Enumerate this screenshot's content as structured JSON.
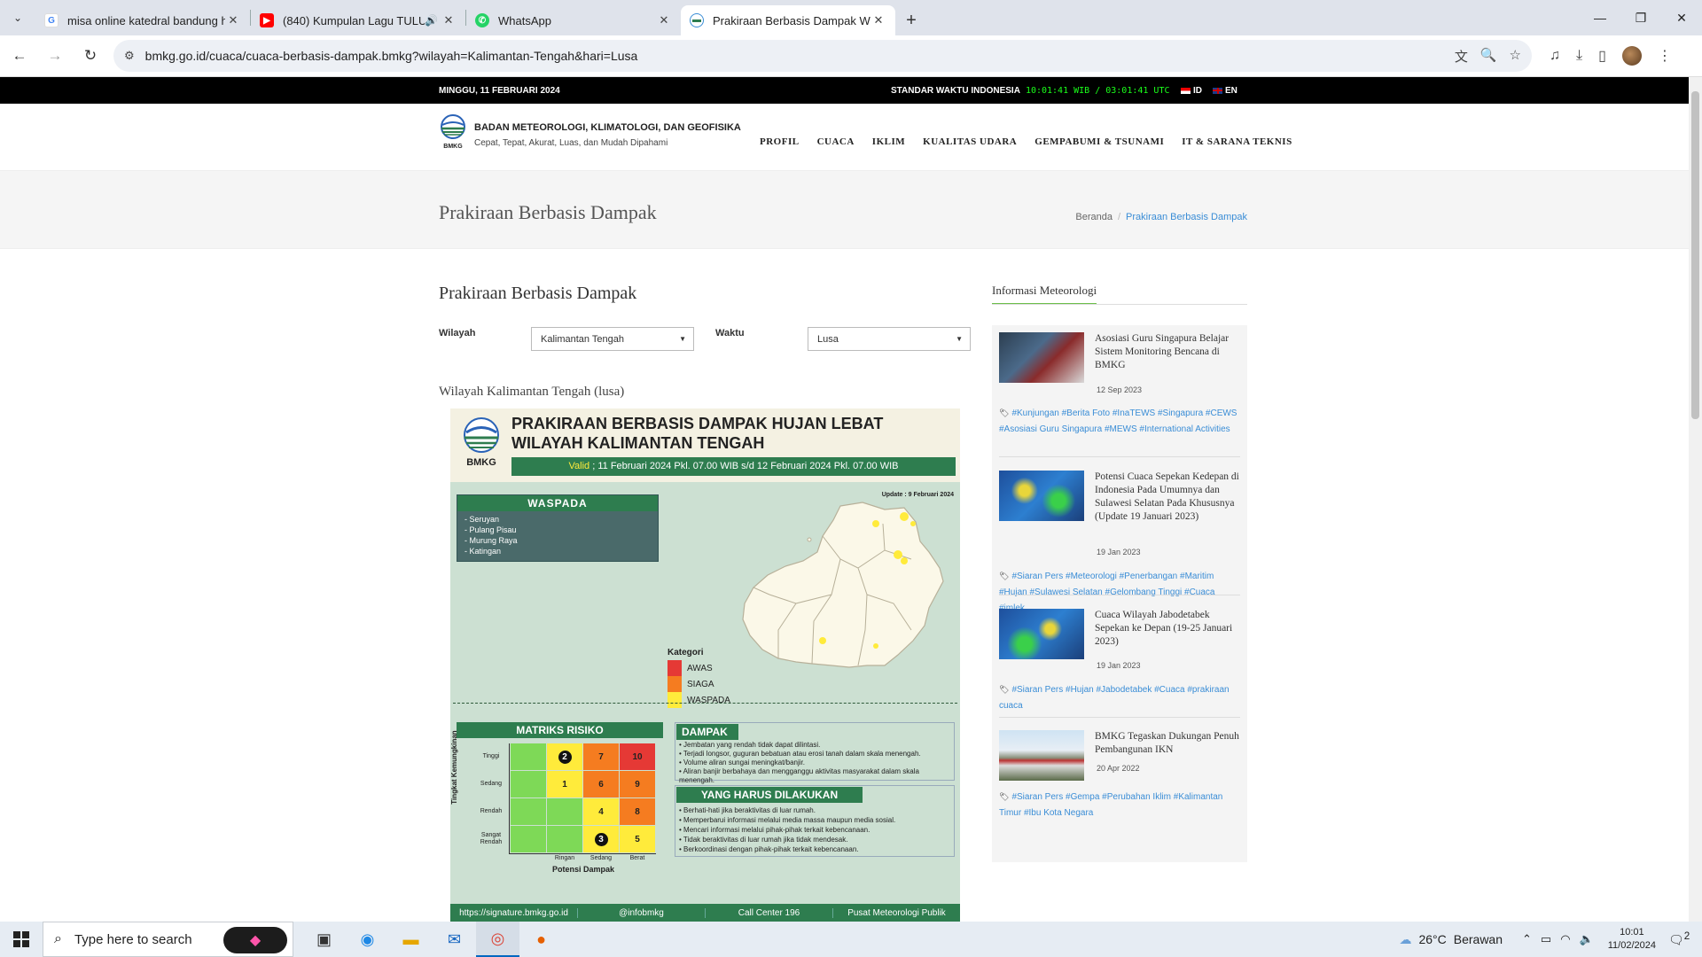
{
  "browser": {
    "tabs": [
      {
        "title": "misa online katedral bandung h",
        "favicon": "google-icon"
      },
      {
        "title": "(840) Kumpulan Lagu TULU",
        "favicon": "youtube-icon"
      },
      {
        "title": "WhatsApp",
        "favicon": "whatsapp-icon"
      },
      {
        "title": "Prakiraan Berbasis Dampak Wil",
        "favicon": "bmkg-icon"
      }
    ],
    "url": "bmkg.go.id/cuaca/cuaca-berbasis-dampak.bmkg?wilayah=Kalimantan-Tengah&hari=Lusa"
  },
  "topbar": {
    "date": "MINGGU, 11 FEBRUARI 2024",
    "time_label": "STANDAR WAKTU INDONESIA",
    "clock": "10:01:41 WIB / 03:01:41 UTC",
    "lang_id": "ID",
    "lang_en": "EN"
  },
  "header": {
    "logo_text": "BMKG",
    "name": "BADAN METEOROLOGI, KLIMATOLOGI, DAN GEOFISIKA",
    "tagline": "Cepat, Tepat, Akurat, Luas, dan Mudah Dipahami",
    "menu": [
      "PROFIL",
      "CUACA",
      "IKLIM",
      "KUALITAS UDARA",
      "GEMPABUMI & TSUNAMI",
      "IT & SARANA TEKNIS"
    ]
  },
  "page_title": {
    "title": "Prakiraan Berbasis Dampak",
    "breadcrumb_home": "Beranda",
    "breadcrumb_current": "Prakiraan Berbasis Dampak"
  },
  "content": {
    "title": "Prakiraan Berbasis Dampak",
    "wilayah_label": "Wilayah",
    "wilayah_value": "Kalimantan Tengah",
    "waktu_label": "Waktu",
    "waktu_value": "Lusa",
    "region_title": "Wilayah Kalimantan Tengah (lusa)"
  },
  "infographic": {
    "title_line1": "PRAKIRAAN BERBASIS DAMPAK HUJAN LEBAT",
    "title_line2": "WILAYAH KALIMANTAN TENGAH",
    "valid_label": "Valid",
    "valid_text": " ; 11 Februari 2024 Pkl. 07.00 WIB s/d 12 Februari 2024 Pkl. 07.00 WIB",
    "waspada_title": "WASPADA",
    "waspada_list": [
      "- Seruyan",
      "- Pulang Pisau",
      "- Murung Raya",
      "- Katingan"
    ],
    "update": "Update : 9 Februari 2024",
    "kategori_title": "Kategori",
    "kategori": [
      {
        "label": "AWAS",
        "color": "#e53935"
      },
      {
        "label": "SIAGA",
        "color": "#f57c20"
      },
      {
        "label": "WASPADA",
        "color": "#ffeb3b"
      }
    ],
    "matrix_title": "MATRIKS RISIKO",
    "matrix_rows": [
      "Tinggi",
      "Sedang",
      "Rendah",
      "Sangat Rendah"
    ],
    "matrix_cols": [
      "Ringan",
      "Sedang",
      "Berat"
    ],
    "matrix_ylabel": "Tingkat Kemungkinan",
    "matrix_xlabel": "Potensi Dampak",
    "matrix_cells": [
      [
        {
          "v": "",
          "c": "#7ed957"
        },
        {
          "v": "2",
          "c": "#ffeb3b",
          "circle": true
        },
        {
          "v": "7",
          "c": "#f57c20"
        },
        {
          "v": "10",
          "c": "#e53935"
        }
      ],
      [
        {
          "v": "",
          "c": "#7ed957"
        },
        {
          "v": "1",
          "c": "#ffeb3b"
        },
        {
          "v": "6",
          "c": "#f57c20"
        },
        {
          "v": "9",
          "c": "#f57c20"
        }
      ],
      [
        {
          "v": "",
          "c": "#7ed957"
        },
        {
          "v": "",
          "c": "#7ed957"
        },
        {
          "v": "4",
          "c": "#ffeb3b"
        },
        {
          "v": "8",
          "c": "#f57c20"
        }
      ],
      [
        {
          "v": "",
          "c": "#7ed957"
        },
        {
          "v": "",
          "c": "#7ed957"
        },
        {
          "v": "3",
          "c": "#ffeb3b",
          "circle": true
        },
        {
          "v": "5",
          "c": "#ffeb3b"
        }
      ]
    ],
    "dampak_title": "DAMPAK",
    "dampak_list": [
      "• Jembatan yang rendah tidak dapat dilintasi.",
      "• Terjadi longsor, guguran bebatuan atau erosi tanah dalam skala menengah.",
      "• Volume aliran sungai meningkat/banjir.",
      "• Aliran banjir berbahaya dan mengganggu aktivitas masyarakat dalam skala menengah."
    ],
    "harus_title": "YANG HARUS DILAKUKAN",
    "harus_list": [
      "• Berhati-hati jika beraktivitas di luar rumah.",
      "• Memperbarui informasi melalui media massa maupun media sosial.",
      "• Mencari informasi melalui pihak-pihak terkait kebencanaan.",
      "• Tidak beraktivitas di luar rumah jika tidak mendesak.",
      "• Berkoordinasi dengan pihak-pihak terkait kebencanaan."
    ],
    "footer": [
      "https://signature.bmkg.go.id",
      "@infobmkg",
      "Call Center 196",
      "Pusat Meteorologi Publik"
    ]
  },
  "sidebar": {
    "title": "Informasi Meteorologi",
    "news": [
      {
        "title": "Asosiasi Guru Singapura Belajar Sistem Monitoring Bencana di BMKG",
        "date": "12 Sep 2023",
        "tags": "#Kunjungan #Berita Foto #InaTEWS #Singapura #CEWS #Asosiasi Guru Singapura #MEWS #International Activities"
      },
      {
        "title": "Potensi Cuaca Sepekan Kedepan di Indonesia Pada Umumnya dan Sulawesi Selatan Pada Khususnya (Update 19 Januari 2023)",
        "date": "19 Jan 2023",
        "tags": "#Siaran Pers #Meteorologi #Penerbangan #Maritim #Hujan #Sulawesi Selatan #Gelombang Tinggi #Cuaca #imlek"
      },
      {
        "title": "Cuaca Wilayah Jabodetabek Sepekan ke Depan (19-25 Januari 2023)",
        "date": "19 Jan 2023",
        "tags": "#Siaran Pers #Hujan #Jabodetabek #Cuaca #prakiraan cuaca"
      },
      {
        "title": "BMKG Tegaskan Dukungan Penuh Pembangunan IKN",
        "date": "20 Apr 2022",
        "tags": "#Siaran Pers #Gempa #Perubahan Iklim #Kalimantan Timur #Ibu Kota Negara"
      }
    ]
  },
  "taskbar": {
    "search_placeholder": "Type here to search",
    "temperature": "26°C",
    "weather": "Berawan",
    "time": "10:01",
    "date": "11/02/2024",
    "notifications": "2"
  }
}
